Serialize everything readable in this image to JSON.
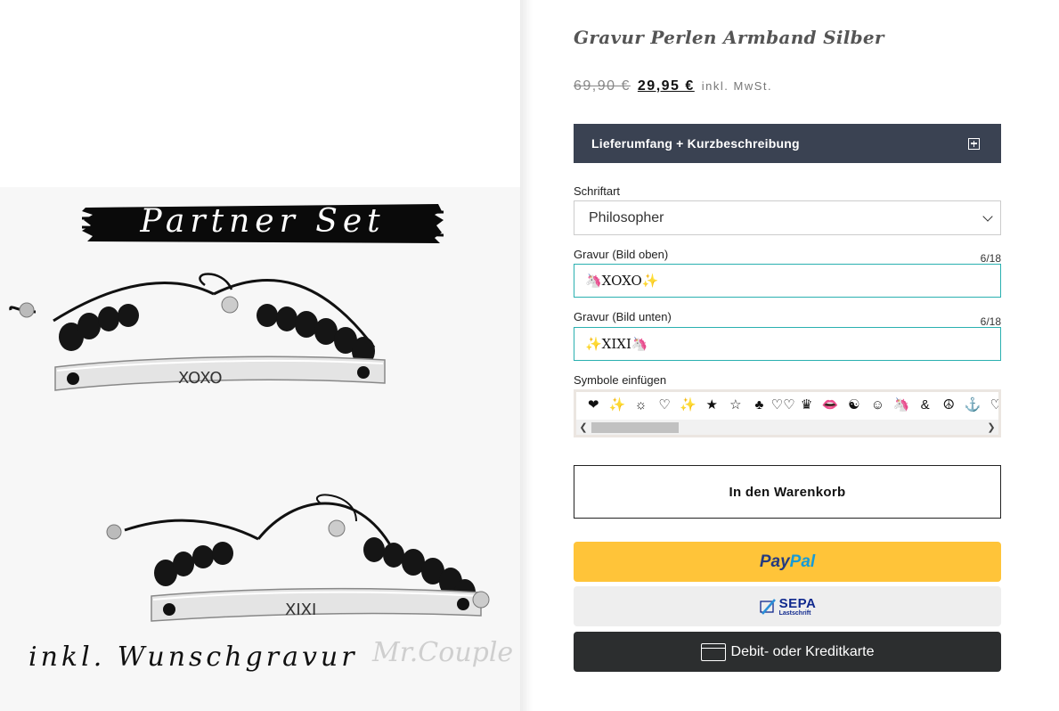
{
  "image": {
    "banner_text": "Partner Set",
    "bottom_text": "inkl. Wunschgravur",
    "watermark": "Mr.Couple",
    "engraving_top": "XOXO",
    "engraving_bottom": "XIXI"
  },
  "product": {
    "title": "Gravur Perlen Armband Silber",
    "old_price": "69,90 €",
    "new_price": "29,95 €",
    "vat_note": "inkl. MwSt."
  },
  "accordion": {
    "label": "Lieferumfang + Kurzbeschreibung"
  },
  "font_select": {
    "label": "Schriftart",
    "value": "Philosopher"
  },
  "engraving_top": {
    "label": "Gravur (Bild oben)",
    "counter": "6/18",
    "value": "🦄XOXO✨"
  },
  "engraving_bottom": {
    "label": "Gravur (Bild unten)",
    "counter": "6/18",
    "value": "✨XIXI🦄"
  },
  "symbols": {
    "label": "Symbole einfügen",
    "items": [
      "❤",
      "✨",
      "☼",
      "♡",
      "✨",
      "★",
      "☆",
      "♣",
      "♡♡",
      "♛",
      "👄",
      "☯",
      "☺",
      "🦄",
      "&",
      "☮",
      "⚓",
      "♡"
    ]
  },
  "actions": {
    "cart_label": "In den Warenkorb",
    "paypal_pay": "Pay",
    "paypal_pal": "Pal",
    "sepa_main": "SEPA",
    "sepa_sub": "Lastschrift",
    "card_label": "Debit- oder Kreditkarte"
  },
  "colors": {
    "accordion_bg": "#3a4252",
    "input_border": "#2ab0b0",
    "paypal_bg": "#ffc439",
    "sepa_bg": "#eeeeee",
    "card_bg": "#2c2e2f"
  }
}
